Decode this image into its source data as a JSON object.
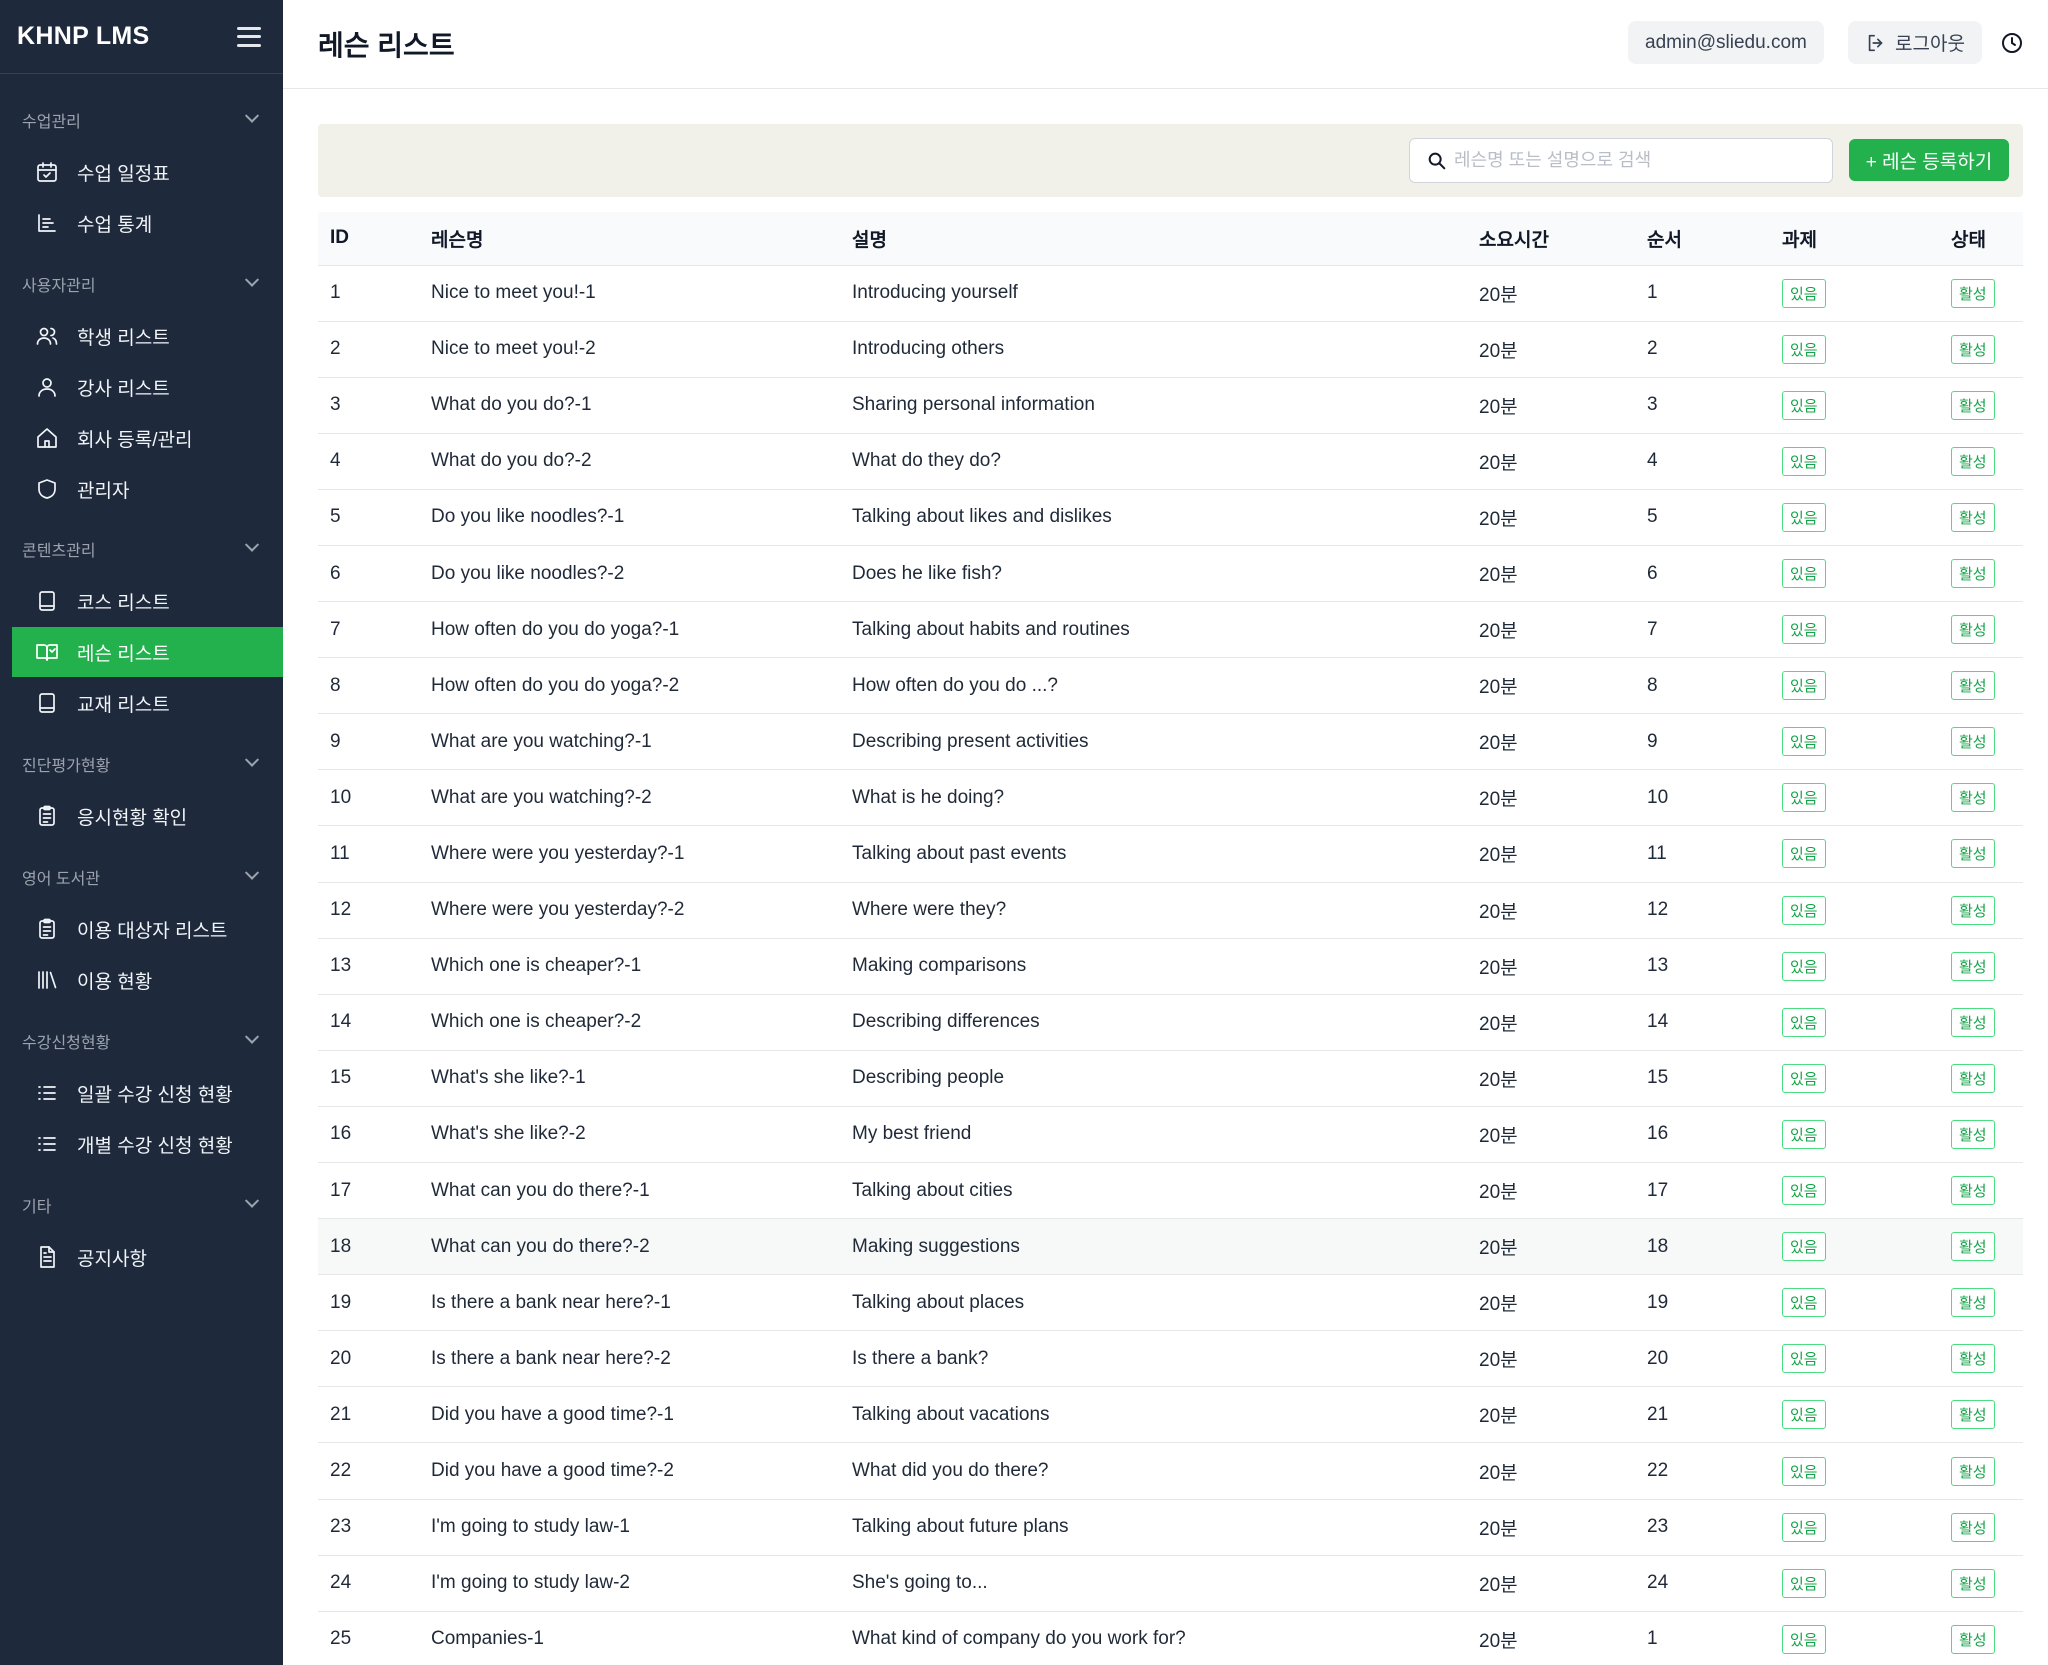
{
  "app": {
    "brand": "KHNP LMS"
  },
  "header": {
    "title": "레슨 리스트",
    "user_email": "admin@sliedu.com",
    "logout_label": "로그아웃"
  },
  "sidebar": {
    "sections": [
      {
        "title": "수업관리",
        "items": [
          {
            "label": "수업 일정표",
            "icon": "calendar-icon"
          },
          {
            "label": "수업 통계",
            "icon": "bar-chart-icon"
          }
        ]
      },
      {
        "title": "사용자관리",
        "items": [
          {
            "label": "학생 리스트",
            "icon": "users-icon"
          },
          {
            "label": "강사 리스트",
            "icon": "user-icon"
          },
          {
            "label": "회사 등록/관리",
            "icon": "home-icon"
          },
          {
            "label": "관리자",
            "icon": "shield-icon"
          }
        ]
      },
      {
        "title": "콘텐츠관리",
        "items": [
          {
            "label": "코스 리스트",
            "icon": "book-icon"
          },
          {
            "label": "레슨 리스트",
            "icon": "book-open-icon",
            "active": true
          },
          {
            "label": "교재 리스트",
            "icon": "book-icon"
          }
        ]
      },
      {
        "title": "진단평가현황",
        "items": [
          {
            "label": "응시현황 확인",
            "icon": "clipboard-icon"
          }
        ]
      },
      {
        "title": "영어 도서관",
        "items": [
          {
            "label": "이용 대상자 리스트",
            "icon": "clipboard-icon"
          },
          {
            "label": "이용 현황",
            "icon": "library-icon"
          }
        ]
      },
      {
        "title": "수강신청현황",
        "items": [
          {
            "label": "일괄 수강 신청 현황",
            "icon": "list-icon"
          },
          {
            "label": "개별 수강 신청 현황",
            "icon": "list-icon"
          }
        ]
      },
      {
        "title": "기타",
        "items": [
          {
            "label": "공지사항",
            "icon": "document-icon"
          }
        ]
      }
    ]
  },
  "toolbar": {
    "search_placeholder": "레슨명 또는 설명으로 검색",
    "add_label": "+ 레슨 등록하기"
  },
  "table": {
    "columns": [
      "ID",
      "레슨명",
      "설명",
      "소요시간",
      "순서",
      "과제",
      "상태"
    ],
    "rows": [
      [
        "1",
        "Nice to meet you!-1",
        "Introducing yourself",
        "20분",
        "1",
        "있음",
        "활성"
      ],
      [
        "2",
        "Nice to meet you!-2",
        "Introducing others",
        "20분",
        "2",
        "있음",
        "활성"
      ],
      [
        "3",
        "What do you do?-1",
        "Sharing personal information",
        "20분",
        "3",
        "있음",
        "활성"
      ],
      [
        "4",
        "What do you do?-2",
        "What do they do?",
        "20분",
        "4",
        "있음",
        "활성"
      ],
      [
        "5",
        "Do you like noodles?-1",
        "Talking about likes and dislikes",
        "20분",
        "5",
        "있음",
        "활성"
      ],
      [
        "6",
        "Do you like noodles?-2",
        "Does he like fish?",
        "20분",
        "6",
        "있음",
        "활성"
      ],
      [
        "7",
        "How often do you do yoga?-1",
        "Talking about habits and routines",
        "20분",
        "7",
        "있음",
        "활성"
      ],
      [
        "8",
        "How often do you do yoga?-2",
        "How often do you do ...?",
        "20분",
        "8",
        "있음",
        "활성"
      ],
      [
        "9",
        "What are you watching?-1",
        "Describing present activities",
        "20분",
        "9",
        "있음",
        "활성"
      ],
      [
        "10",
        "What are you watching?-2",
        "What is he doing?",
        "20분",
        "10",
        "있음",
        "활성"
      ],
      [
        "11",
        "Where were you yesterday?-1",
        "Talking about past events",
        "20분",
        "11",
        "있음",
        "활성"
      ],
      [
        "12",
        "Where were you yesterday?-2",
        "Where were they?",
        "20분",
        "12",
        "있음",
        "활성"
      ],
      [
        "13",
        "Which one is cheaper?-1",
        "Making comparisons",
        "20분",
        "13",
        "있음",
        "활성"
      ],
      [
        "14",
        "Which one is cheaper?-2",
        "Describing differences",
        "20분",
        "14",
        "있음",
        "활성"
      ],
      [
        "15",
        "What's she like?-1",
        "Describing people",
        "20분",
        "15",
        "있음",
        "활성"
      ],
      [
        "16",
        "What's she like?-2",
        "My best friend",
        "20분",
        "16",
        "있음",
        "활성"
      ],
      [
        "17",
        "What can you do there?-1",
        "Talking about cities",
        "20분",
        "17",
        "있음",
        "활성"
      ],
      [
        "18",
        "What can you do there?-2",
        "Making suggestions",
        "20분",
        "18",
        "있음",
        "활성"
      ],
      [
        "19",
        "Is there a bank near here?-1",
        "Talking about places",
        "20분",
        "19",
        "있음",
        "활성"
      ],
      [
        "20",
        "Is there a bank near here?-2",
        "Is there a bank?",
        "20분",
        "20",
        "있음",
        "활성"
      ],
      [
        "21",
        "Did you have a good time?-1",
        "Talking about vacations",
        "20분",
        "21",
        "있음",
        "활성"
      ],
      [
        "22",
        "Did you have a good time?-2",
        "What did you do there?",
        "20분",
        "22",
        "있음",
        "활성"
      ],
      [
        "23",
        "I'm going to study law-1",
        "Talking about future plans",
        "20분",
        "23",
        "있음",
        "활성"
      ],
      [
        "24",
        "I'm going to study law-2",
        "She's going to...",
        "20분",
        "24",
        "있음",
        "활성"
      ],
      [
        "25",
        "Companies-1",
        "What kind of company do you work for?",
        "20분",
        "1",
        "있음",
        "활성"
      ]
    ]
  },
  "colors": {
    "sidebar_bg": "#1e293b",
    "accent_green": "#22b14c",
    "tag_green": "#16a34a",
    "toolbar_bg": "#f1f1ea"
  }
}
